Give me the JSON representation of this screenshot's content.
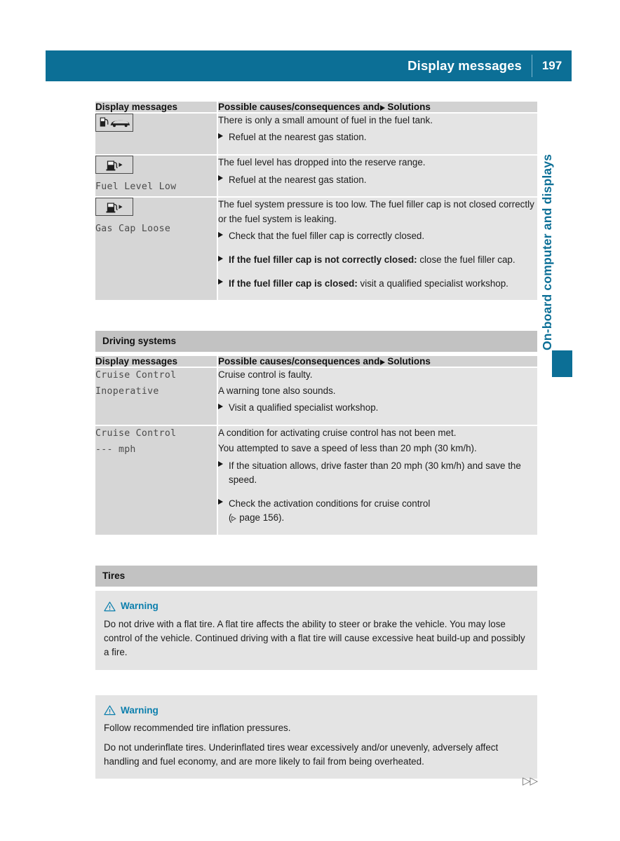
{
  "header": {
    "title": "Display messages",
    "page_number": "197"
  },
  "side": {
    "chapter_label": "On-board computer and displays"
  },
  "footer": {
    "continuation_arrows": "▷▷"
  },
  "table_fuel": {
    "col1_header": "Display messages",
    "col2_header_before": "Possible causes/consequences and",
    "col2_header_after": "Solutions",
    "rows": [
      {
        "icon_name": "fuel-pump-car-icon",
        "message": "",
        "lines": [
          {
            "type": "text",
            "text": "There is only a small amount of fuel in the fuel tank."
          },
          {
            "type": "bullet",
            "text": "Refuel at the nearest gas station."
          }
        ]
      },
      {
        "icon_name": "fuel-pump-arrow-icon",
        "message": "Fuel Level Low",
        "lines": [
          {
            "type": "text",
            "text": "The fuel level has dropped into the reserve range."
          },
          {
            "type": "bullet",
            "text": "Refuel at the nearest gas station."
          }
        ]
      },
      {
        "icon_name": "fuel-pump-arrow-icon",
        "message": "Gas Cap Loose",
        "lines": [
          {
            "type": "text",
            "text": "The fuel system pressure is too low. The fuel filler cap is not closed correctly or the fuel system is leaking."
          },
          {
            "type": "bullet",
            "text": "Check that the fuel filler cap is correctly closed."
          },
          {
            "type": "bullet",
            "bold": "If the fuel filler cap is not correctly closed:",
            "text": " close the fuel filler cap."
          },
          {
            "type": "bullet",
            "bold": "If the fuel filler cap is closed:",
            "text": " visit a qualified specialist workshop."
          }
        ]
      }
    ]
  },
  "section_driving": {
    "band_title": "Driving systems",
    "col1_header": "Display messages",
    "col2_header_before": "Possible causes/consequences and",
    "col2_header_after": "Solutions",
    "rows": [
      {
        "message": "Cruise Control\nInoperative",
        "lines": [
          {
            "type": "text",
            "text": "Cruise control is faulty."
          },
          {
            "type": "text",
            "text": "A warning tone also sounds."
          },
          {
            "type": "bullet",
            "text": "Visit a qualified specialist workshop."
          }
        ]
      },
      {
        "message": "Cruise Control\n--- mph",
        "lines": [
          {
            "type": "text",
            "text": "A condition for activating cruise control has not been met."
          },
          {
            "type": "text",
            "text": "You attempted to save a speed of less than 20 mph (30 km/h)."
          },
          {
            "type": "bullet",
            "text": "If the situation allows, drive faster than 20 mph (30 km/h) and save the speed."
          },
          {
            "type": "bullet_ref",
            "text": "Check the activation conditions for cruise control",
            "ref": "page 156)."
          }
        ]
      }
    ]
  },
  "section_tires": {
    "band_title": "Tires",
    "warnings": [
      {
        "title": "Warning",
        "paragraphs": [
          "Do not drive with a flat tire. A flat tire affects the ability to steer or brake the vehicle. You may lose control of the vehicle. Continued driving with a flat tire will cause excessive heat build-up and possibly a fire."
        ]
      },
      {
        "title": "Warning",
        "paragraphs": [
          "Follow recommended tire inflation pressures.",
          "Do not underinflate tires. Underinflated tires wear excessively and/or unevenly, adversely affect handling and fuel economy, and are more likely to fail from being overheated."
        ]
      }
    ]
  },
  "colors": {
    "accent_blue": "#0c6f96",
    "warning_blue": "#0c7fad",
    "band_gray": "#c2c2c2",
    "cell_left_gray": "#d6d6d6",
    "cell_right_gray": "#e4e4e4"
  }
}
